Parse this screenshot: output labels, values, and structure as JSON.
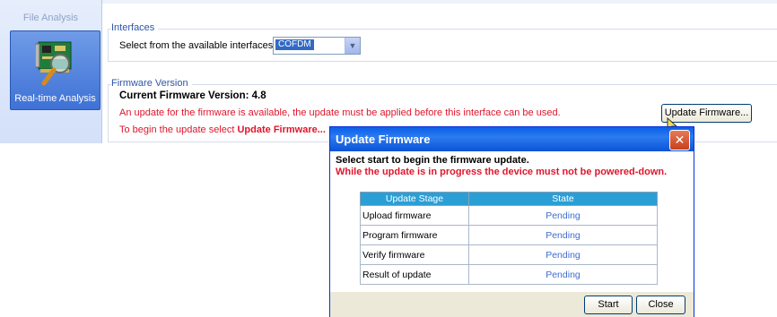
{
  "nav": {
    "file_analysis": "File Analysis",
    "realtime_analysis": "Real-time Analysis",
    "realtime_icon": "network-card-magnifier-icon"
  },
  "interfaces": {
    "group_title": "Interfaces",
    "select_label": "Select from the available interfaces",
    "selected_value": "COFDM"
  },
  "firmware": {
    "group_title": "Firmware Version",
    "current_version": "Current Firmware Version: 4.8",
    "update_notice": "An update for the firmware is available, the update must be applied before this interface can be used.",
    "instruction_prefix": "To begin the update select ",
    "instruction_bold": "Update Firmware...",
    "update_button": "Update Firmware..."
  },
  "dialog": {
    "title": "Update Firmware",
    "close_icon": "close-icon",
    "message": "Select start to begin the firmware update.",
    "warning": "While the update is in progress the device must not be powered-down.",
    "table_headers": [
      "Update Stage",
      "State"
    ],
    "rows": [
      {
        "stage": "Upload firmware",
        "state": "Pending"
      },
      {
        "stage": "Program firmware",
        "state": "Pending"
      },
      {
        "stage": "Verify firmware",
        "state": "Pending"
      },
      {
        "stage": "Result of update",
        "state": "Pending"
      }
    ],
    "start_button": "Start",
    "close_button": "Close"
  },
  "colors": {
    "accent_blue": "#316ac5",
    "warning_red": "#e0152b",
    "title_bar": "#0a5fe8",
    "table_header": "#2a9fd6"
  }
}
